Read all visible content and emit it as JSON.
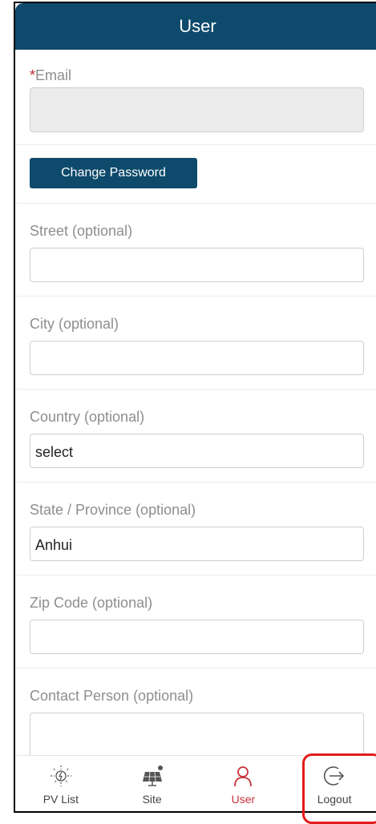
{
  "header": {
    "title": "User"
  },
  "form": {
    "email": {
      "label": "Email",
      "required_mark": "*",
      "value": ""
    },
    "change_password_label": "Change Password",
    "street": {
      "label": "Street (optional)",
      "value": ""
    },
    "city": {
      "label": "City (optional)",
      "value": ""
    },
    "country": {
      "label": "Country (optional)",
      "value": "select"
    },
    "state": {
      "label": "State / Province (optional)",
      "value": "Anhui"
    },
    "zip": {
      "label": "Zip Code (optional)",
      "value": ""
    },
    "contact": {
      "label": "Contact Person (optional)",
      "value": ""
    }
  },
  "tabbar": {
    "items": [
      {
        "label": "PV List",
        "icon": "pv-list-icon"
      },
      {
        "label": "Site",
        "icon": "site-icon"
      },
      {
        "label": "User",
        "icon": "user-icon",
        "active": true
      },
      {
        "label": "Logout",
        "icon": "logout-icon"
      }
    ]
  },
  "colors": {
    "primary": "#0d4a6b",
    "active": "#c8323a",
    "highlight": "#e21b1b",
    "required": "#c0282d"
  }
}
